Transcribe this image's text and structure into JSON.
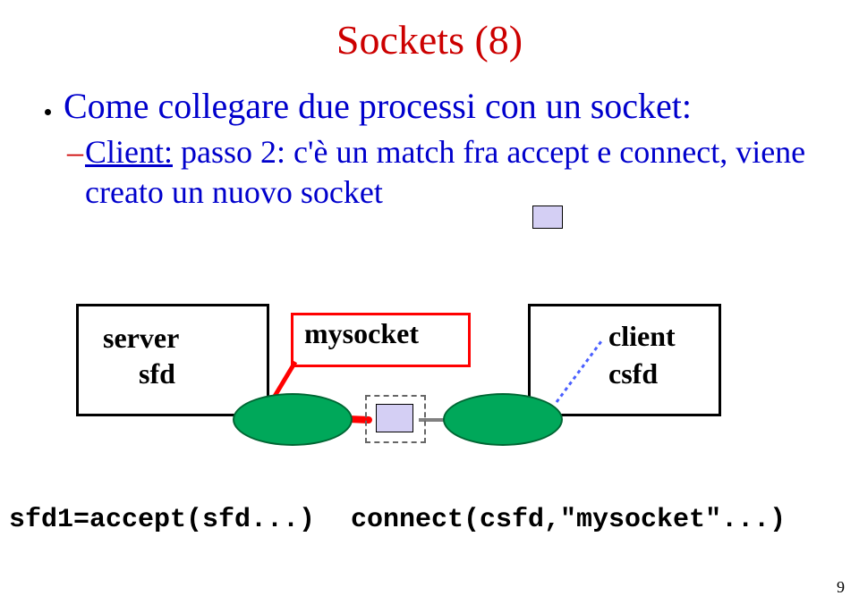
{
  "title": "Sockets (8)",
  "bullet": "Come collegare due processi con un socket:",
  "sub_lead": "Client:",
  "sub_rest": " passo 2: c'è un match fra accept e connect, viene creato un nuovo socket",
  "server": {
    "label1": "server",
    "label2": "sfd"
  },
  "mysocket": "mysocket",
  "client": {
    "label1": "client",
    "label2": "csfd"
  },
  "code_left": "sfd1=accept(sfd...)",
  "code_right": "connect(csfd,\"mysocket\"...)",
  "page": "9"
}
